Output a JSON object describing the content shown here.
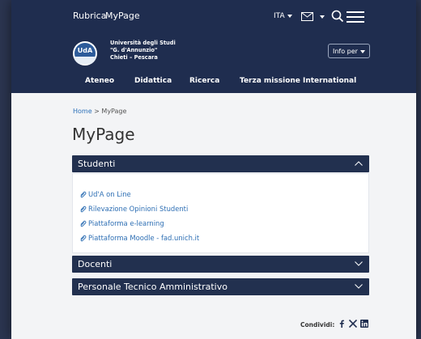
{
  "topbar": {
    "rubrica": "Rubrica",
    "mypage": "MyPage",
    "language": "ITA"
  },
  "institution": {
    "logo_text": "UdA",
    "name_line1": "Università degli Studi",
    "name_line2": "\"G. d'Annunzio\"",
    "name_line3": "Chieti – Pescara",
    "info_button": "Info per"
  },
  "nav": [
    "Ateneo",
    "Didattica",
    "Ricerca",
    "Terza missione",
    "International"
  ],
  "breadcrumb": {
    "home": "Home",
    "separator": ">",
    "current": "MyPage"
  },
  "page_title": "MyPage",
  "accordion": {
    "studenti": {
      "title": "Studenti",
      "expanded": true,
      "links": [
        "Ud'A on Line",
        "Rilevazione Opinioni Studenti",
        "Piattaforma e-learning",
        "Piattaforma Moodle - fad.unich.it"
      ]
    },
    "docenti": {
      "title": "Docenti",
      "expanded": false
    },
    "personale": {
      "title": "Personale Tecnico Amministrativo",
      "expanded": false
    }
  },
  "share": {
    "label": "Condividi:",
    "icons": [
      "facebook-icon",
      "x-icon",
      "linkedin-icon"
    ]
  },
  "colors": {
    "header": "#1f2d4f",
    "accordion": "#22304f",
    "link": "#2e6fb4",
    "background": "#f3f4f6"
  }
}
